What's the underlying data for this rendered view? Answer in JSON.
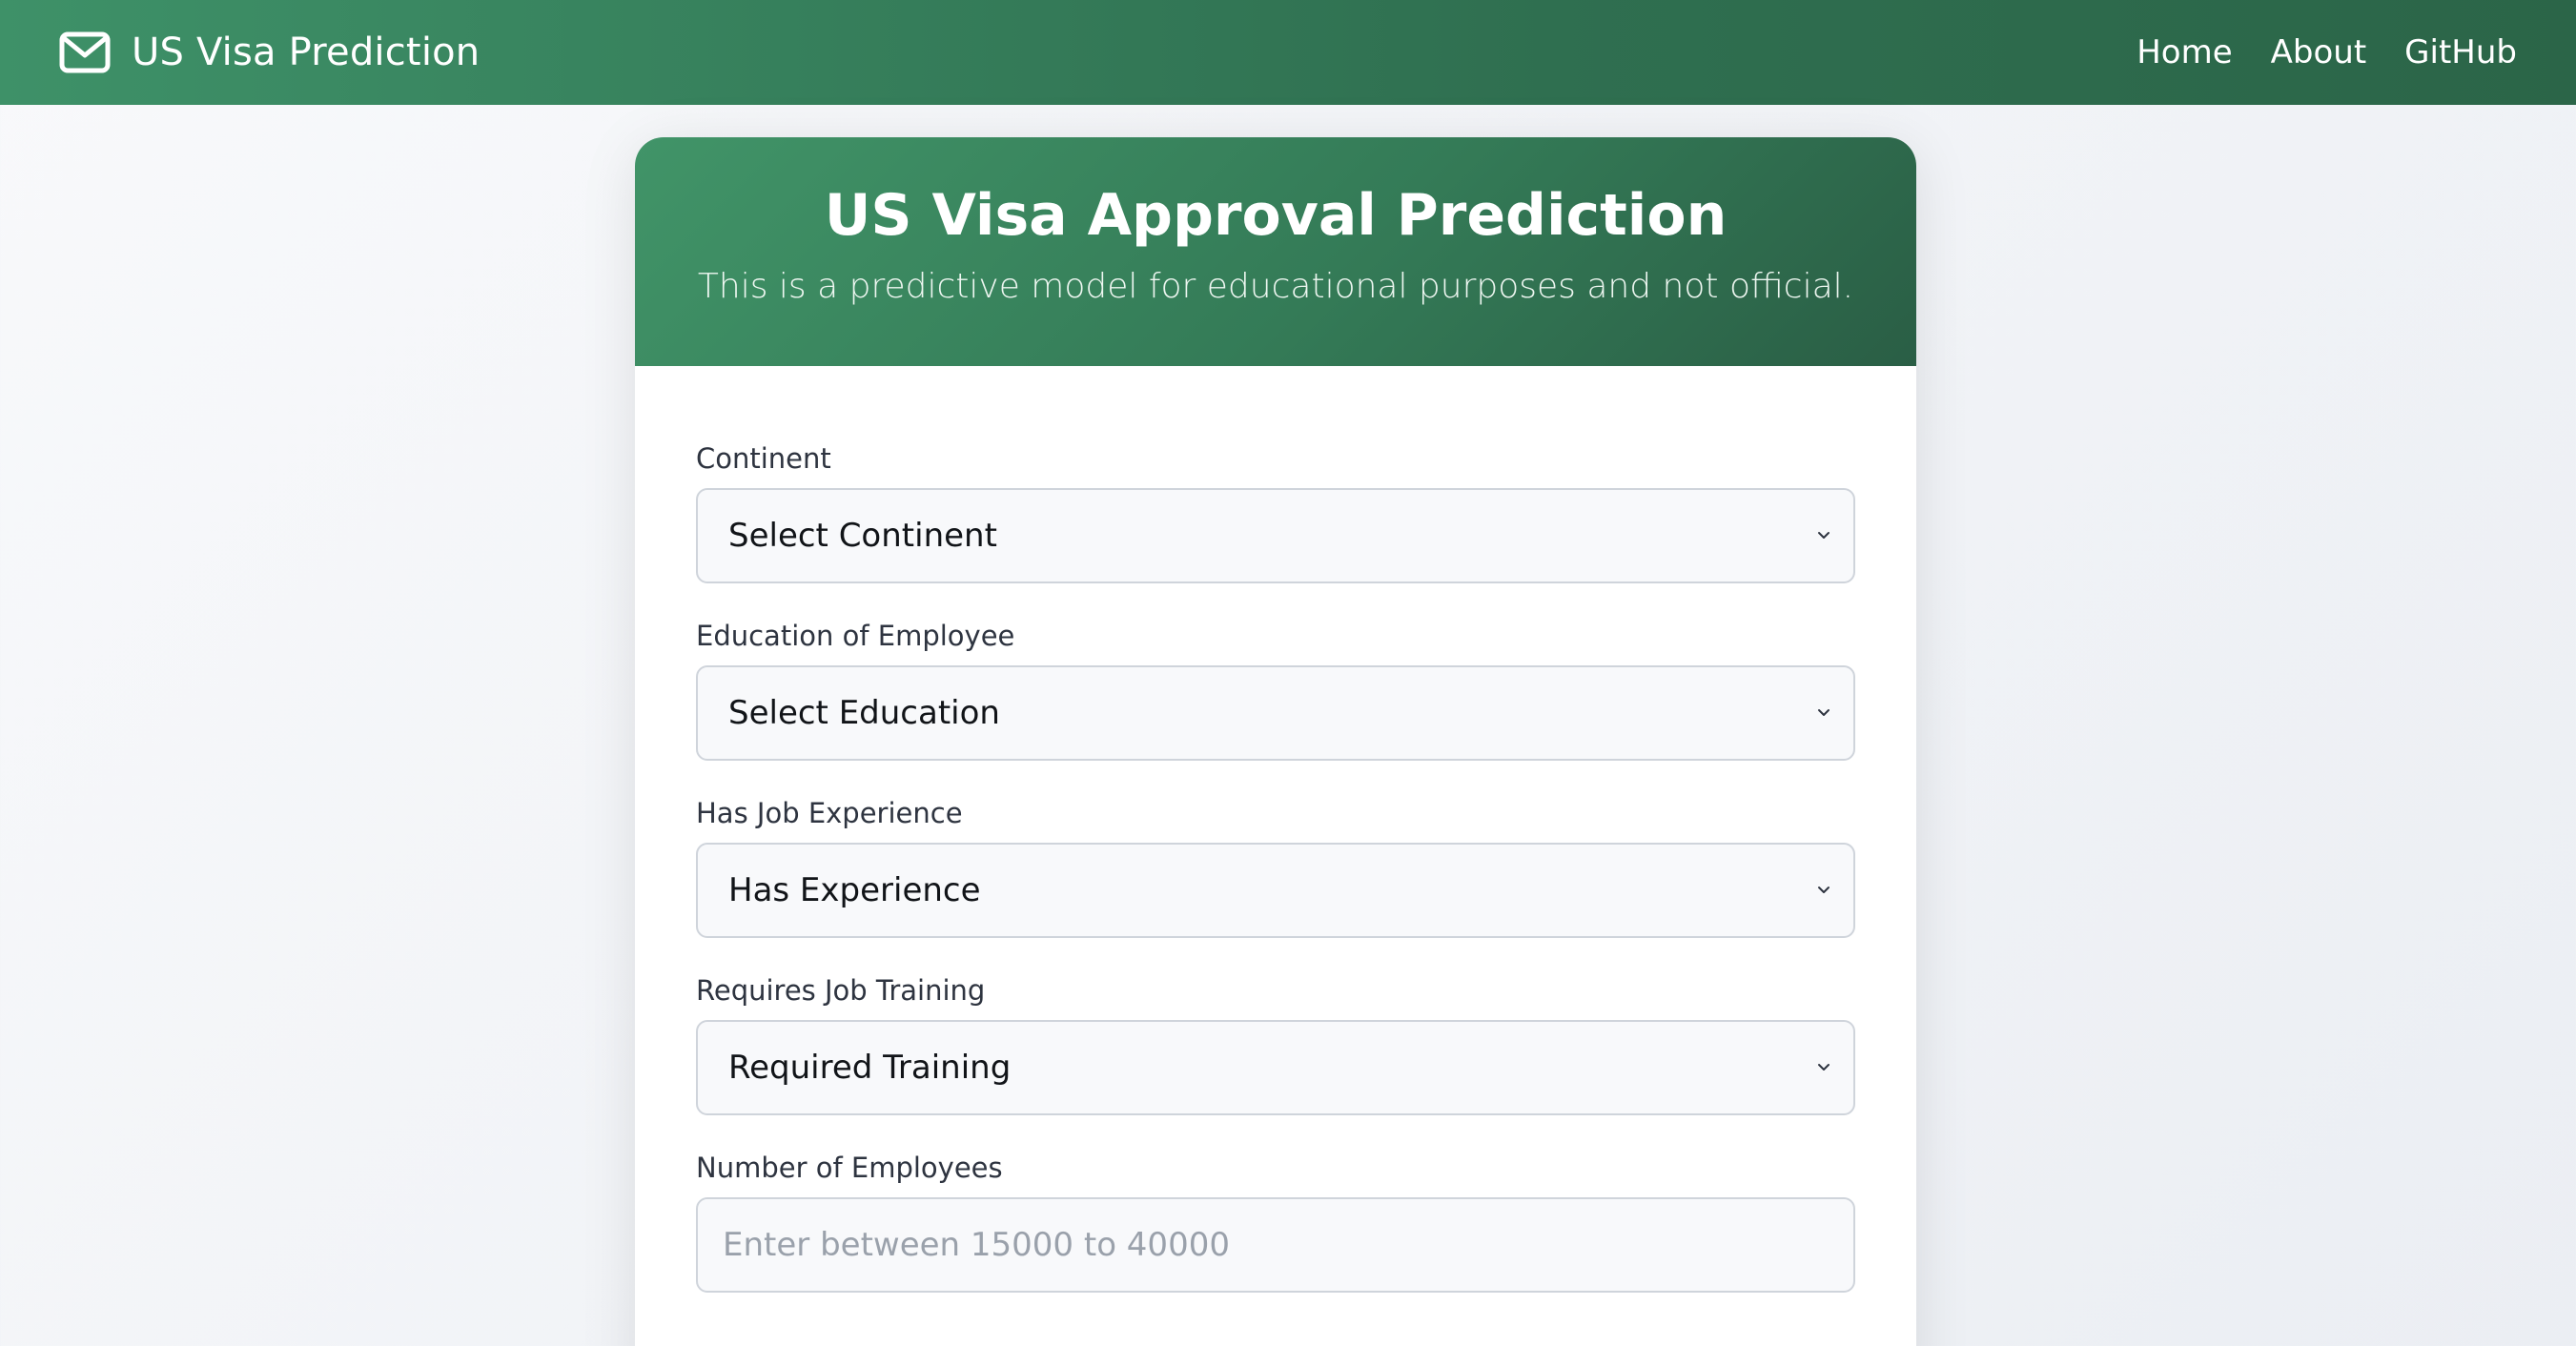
{
  "navbar": {
    "brand_icon": "envelope-icon",
    "brand_title": "US Visa Prediction",
    "links": [
      "Home",
      "About",
      "GitHub"
    ]
  },
  "card": {
    "title": "US Visa Approval Prediction",
    "subtitle": "This is a predictive model for educational purposes and not official."
  },
  "form": {
    "fields": [
      {
        "label": "Continent",
        "type": "select",
        "value": "Select Continent"
      },
      {
        "label": "Education of Employee",
        "type": "select",
        "value": "Select Education"
      },
      {
        "label": "Has Job Experience",
        "type": "select",
        "value": "Has Experience"
      },
      {
        "label": "Requires Job Training",
        "type": "select",
        "value": "Required Training"
      },
      {
        "label": "Number of Employees",
        "type": "input",
        "placeholder": "Enter between 15000 to 40000"
      }
    ]
  },
  "colors": {
    "header_green": "#3e9168",
    "header_dark_green": "#2a5e45",
    "page_background": "#f3f4f7"
  }
}
